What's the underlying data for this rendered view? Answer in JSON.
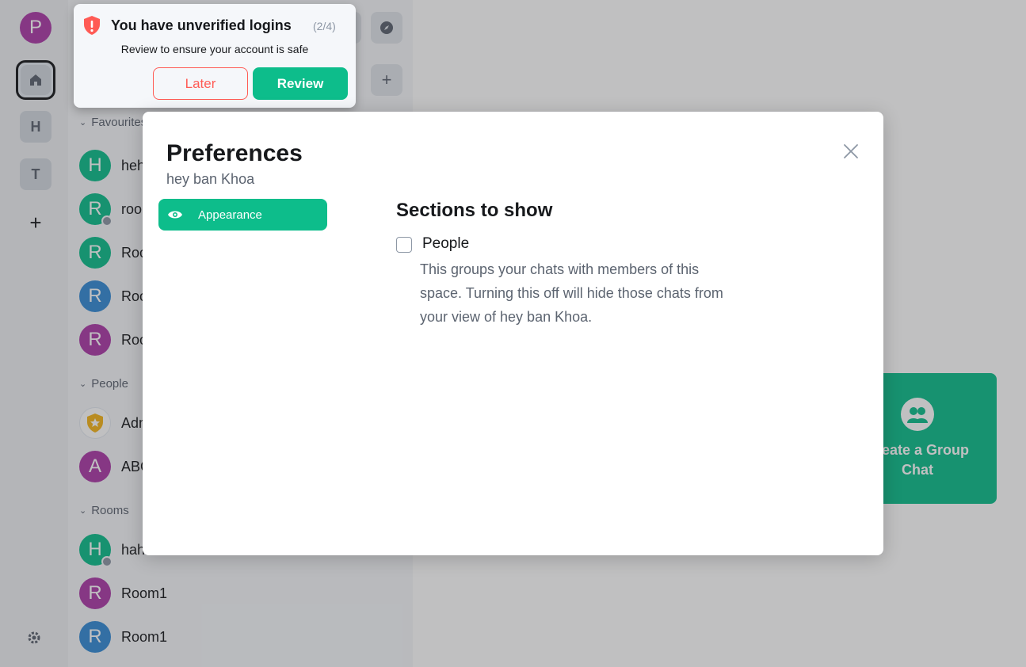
{
  "space_panel": {
    "user_avatar_letter": "P",
    "spaces": [
      {
        "letter": "H"
      },
      {
        "letter": "T"
      }
    ],
    "add_label": "+",
    "colors": {
      "user_avatar": "#ac3ba8",
      "accent": "#0dbd8b"
    }
  },
  "room_list": {
    "sections": [
      {
        "name": "Favourites"
      },
      {
        "name": "People"
      },
      {
        "name": "Rooms"
      }
    ],
    "favourites": [
      {
        "letter": "H",
        "name": "hehe",
        "color": "#0dbd8b",
        "public": false
      },
      {
        "letter": "R",
        "name": "room",
        "color": "#0dbd8b",
        "public": true
      },
      {
        "letter": "R",
        "name": "Room",
        "color": "#0dbd8b",
        "public": false
      },
      {
        "letter": "R",
        "name": "Room",
        "color": "#368bd6",
        "public": false
      },
      {
        "letter": "R",
        "name": "Room",
        "color": "#ac3ba8",
        "public": false
      }
    ],
    "people": [
      {
        "letter": "",
        "name": "Admin",
        "color": "#ffffff",
        "icon": "shield-star-icon"
      },
      {
        "letter": "A",
        "name": "ABC",
        "color": "#ac3ba8"
      }
    ],
    "rooms": [
      {
        "letter": "H",
        "name": "haha",
        "color": "#0dbd8b",
        "public": true
      },
      {
        "letter": "R",
        "name": "Room1",
        "color": "#ac3ba8",
        "public": false
      },
      {
        "letter": "R",
        "name": "Room1",
        "color": "#368bd6",
        "public": false
      }
    ]
  },
  "main": {
    "group_card_label": "Create a Group Chat"
  },
  "toast": {
    "title": "You have unverified logins",
    "count": "(2/4)",
    "description": "Review to ensure your account is safe",
    "later_label": "Later",
    "review_label": "Review"
  },
  "dialog": {
    "title": "Preferences",
    "subtitle": "hey ban Khoa",
    "tabs": [
      {
        "label": "Appearance",
        "icon": "eye-icon"
      }
    ],
    "section_heading": "Sections to show",
    "people_option": {
      "label": "People",
      "checked": false,
      "description": "This groups your chats with members of this space. Turning this off will hide those chats from your view of hey ban Khoa."
    }
  }
}
